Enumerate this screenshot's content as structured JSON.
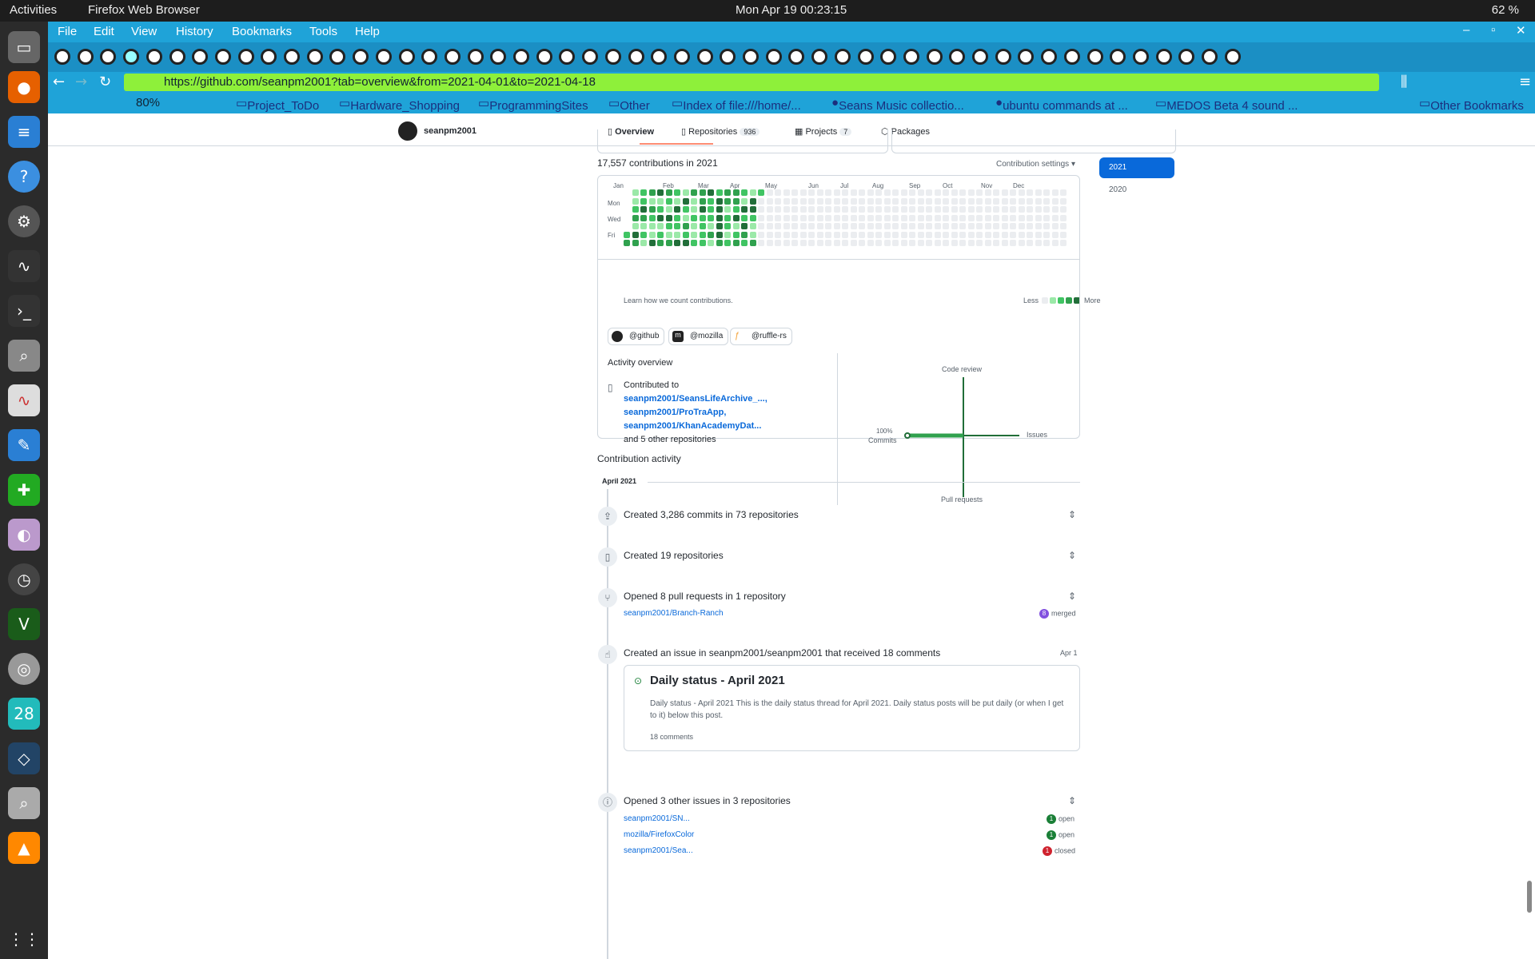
{
  "system": {
    "activities": "Activities",
    "app_name": "Firefox Web Browser",
    "clock": "Mon Apr 19  00:23:15",
    "battery": "62 %"
  },
  "menu": [
    "File",
    "Edit",
    "View",
    "History",
    "Bookmarks",
    "Tools",
    "Help"
  ],
  "url": "https://github.com/seanpm2001?tab=overview&from=2021-04-01&to=2021-04-18",
  "zoom": "80%",
  "bookmarks": [
    "Project_ToDo",
    "Hardware_Shopping",
    "ProgrammingSites",
    "Other",
    "Index of file:///home/...",
    "Seans Music collectio...",
    "ubuntu commands at ...",
    "MEDOS Beta 4 sound ...",
    "Other Bookmarks"
  ],
  "profile": {
    "username": "seanpm2001",
    "tabs": [
      {
        "label": "Overview",
        "count": ""
      },
      {
        "label": "Repositories",
        "count": "936"
      },
      {
        "label": "Projects",
        "count": "7"
      },
      {
        "label": "Packages",
        "count": ""
      }
    ]
  },
  "contrib": {
    "title": "17,557 contributions in 2021",
    "settings": "Contribution settings ▾",
    "months": [
      "Jan",
      "Feb",
      "Mar",
      "Apr",
      "May",
      "Jun",
      "Jul",
      "Aug",
      "Sep",
      "Oct",
      "Nov",
      "Dec"
    ],
    "days": [
      "Mon",
      "Wed",
      "Fri"
    ],
    "learn": "Learn how we count contributions.",
    "less": "Less",
    "more": "More",
    "years": [
      "2021",
      "2020"
    ]
  },
  "orgs": [
    "@github",
    "@mozilla",
    "@ruffle-rs"
  ],
  "overview": {
    "title": "Activity overview",
    "contributed_to": "Contributed to",
    "repos": [
      "seanpm2001/SeansLifeArchive_...,",
      "seanpm2001/ProTraApp,",
      "seanpm2001/KhanAcademyDat..."
    ],
    "others": "and 5 other repositories",
    "axes": {
      "top": "Code review",
      "left_pct": "100%",
      "left": "Commits",
      "right": "Issues",
      "bottom": "Pull requests"
    }
  },
  "activity": {
    "heading": "Contribution activity",
    "month": "April 2021",
    "items": [
      {
        "text": "Created 3,286 commits in 73 repositories"
      },
      {
        "text": "Created 19 repositories"
      },
      {
        "text": "Opened 8 pull requests in 1 repository",
        "repo": "seanpm2001/Branch-Ranch",
        "count": "8",
        "status": "merged"
      },
      {
        "text": "Created an issue in seanpm2001/seanpm2001 that received 18 comments",
        "date": "Apr 1"
      },
      {
        "text": "Opened 3 other issues in 3 repositories"
      }
    ],
    "issue_card": {
      "title": "Daily status - April 2021",
      "body": "Daily status - April 2021 This is the daily status thread for April 2021. Daily status posts will be put daily (or when I get to it) below this post.",
      "comments": "18 comments"
    },
    "other_issues": [
      {
        "repo": "seanpm2001/SN...",
        "count": "1",
        "status": "open"
      },
      {
        "repo": "mozilla/FirefoxColor",
        "count": "1",
        "status": "open"
      },
      {
        "repo": "seanpm2001/Sea...",
        "count": "1",
        "status": "closed"
      }
    ]
  },
  "colors": {
    "accent": "#0969da",
    "green_dark": "#216e39",
    "green": "#40c463",
    "merged": "#8250df"
  }
}
